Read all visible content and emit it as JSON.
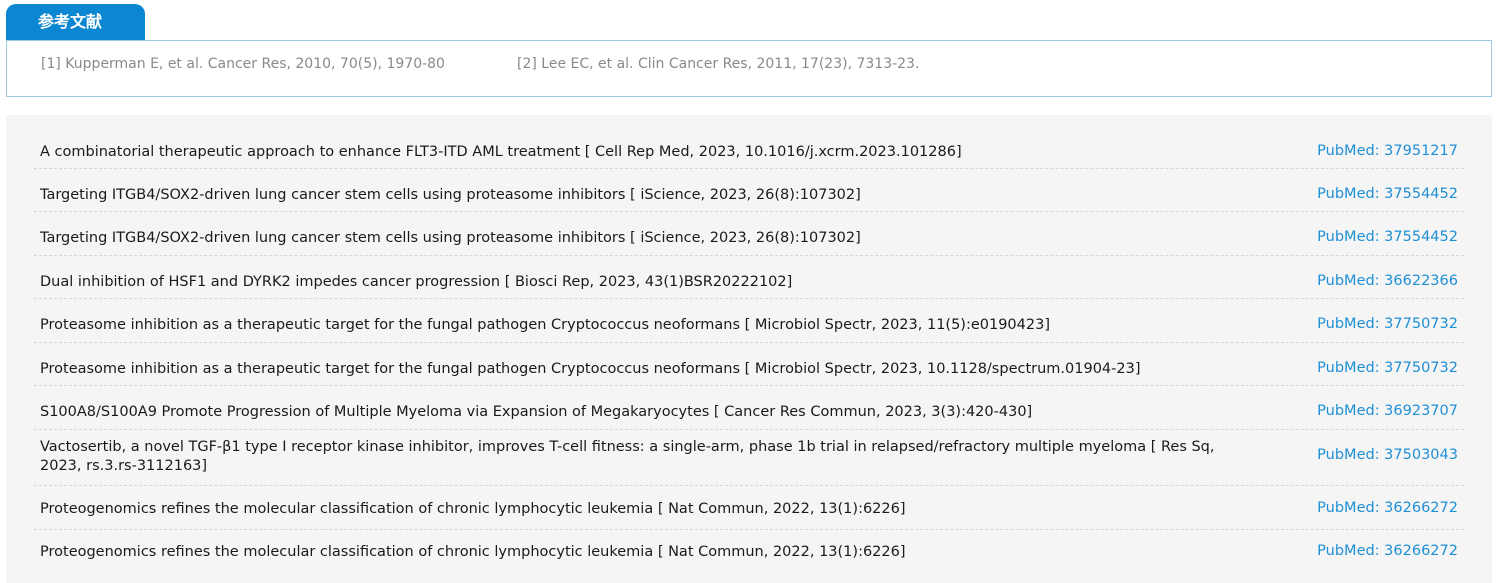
{
  "tab": {
    "label": "参考文献"
  },
  "references": [
    "[1] Kupperman E, et al. Cancer Res, 2010, 70(5), 1970-80",
    "[2] Lee EC, et al. Clin Cancer Res, 2011, 17(23), 7313-23."
  ],
  "publications": [
    {
      "text": "A combinatorial therapeutic approach to enhance FLT3-ITD AML treatment [ Cell Rep Med, 2023, 10.1016/j.xcrm.2023.101286]",
      "pubmed": "PubMed: 37951217"
    },
    {
      "text": "Targeting ITGB4/SOX2-driven lung cancer stem cells using proteasome inhibitors [ iScience, 2023, 26(8):107302]",
      "pubmed": "PubMed: 37554452"
    },
    {
      "text": "Targeting ITGB4/SOX2-driven lung cancer stem cells using proteasome inhibitors [ iScience, 2023, 26(8):107302]",
      "pubmed": "PubMed: 37554452"
    },
    {
      "text": "Dual inhibition of HSF1 and DYRK2 impedes cancer progression [ Biosci Rep, 2023, 43(1)BSR20222102]",
      "pubmed": "PubMed: 36622366"
    },
    {
      "text": "Proteasome inhibition as a therapeutic target for the fungal pathogen Cryptococcus neoformans [ Microbiol Spectr, 2023, 11(5):e0190423]",
      "pubmed": "PubMed: 37750732"
    },
    {
      "text": "Proteasome inhibition as a therapeutic target for the fungal pathogen Cryptococcus neoformans [ Microbiol Spectr, 2023, 10.1128/spectrum.01904-23]",
      "pubmed": "PubMed: 37750732"
    },
    {
      "text": "S100A8/S100A9 Promote Progression of Multiple Myeloma via Expansion of Megakaryocytes [ Cancer Res Commun, 2023, 3(3):420-430]",
      "pubmed": "PubMed: 36923707"
    },
    {
      "text": "Vactosertib, a novel TGF-β1 type I receptor kinase inhibitor, improves T-cell fitness: a single-arm, phase 1b trial in relapsed/refractory multiple myeloma [ Res Sq, 2023, rs.3.rs-3112163]",
      "pubmed": "PubMed: 37503043"
    },
    {
      "text": "Proteogenomics refines the molecular classification of chronic lymphocytic leukemia [ Nat Commun, 2022, 13(1):6226]",
      "pubmed": "PubMed: 36266272"
    },
    {
      "text": "Proteogenomics refines the molecular classification of chronic lymphocytic leukemia [ Nat Commun, 2022, 13(1):6226]",
      "pubmed": "PubMed: 36266272"
    }
  ]
}
